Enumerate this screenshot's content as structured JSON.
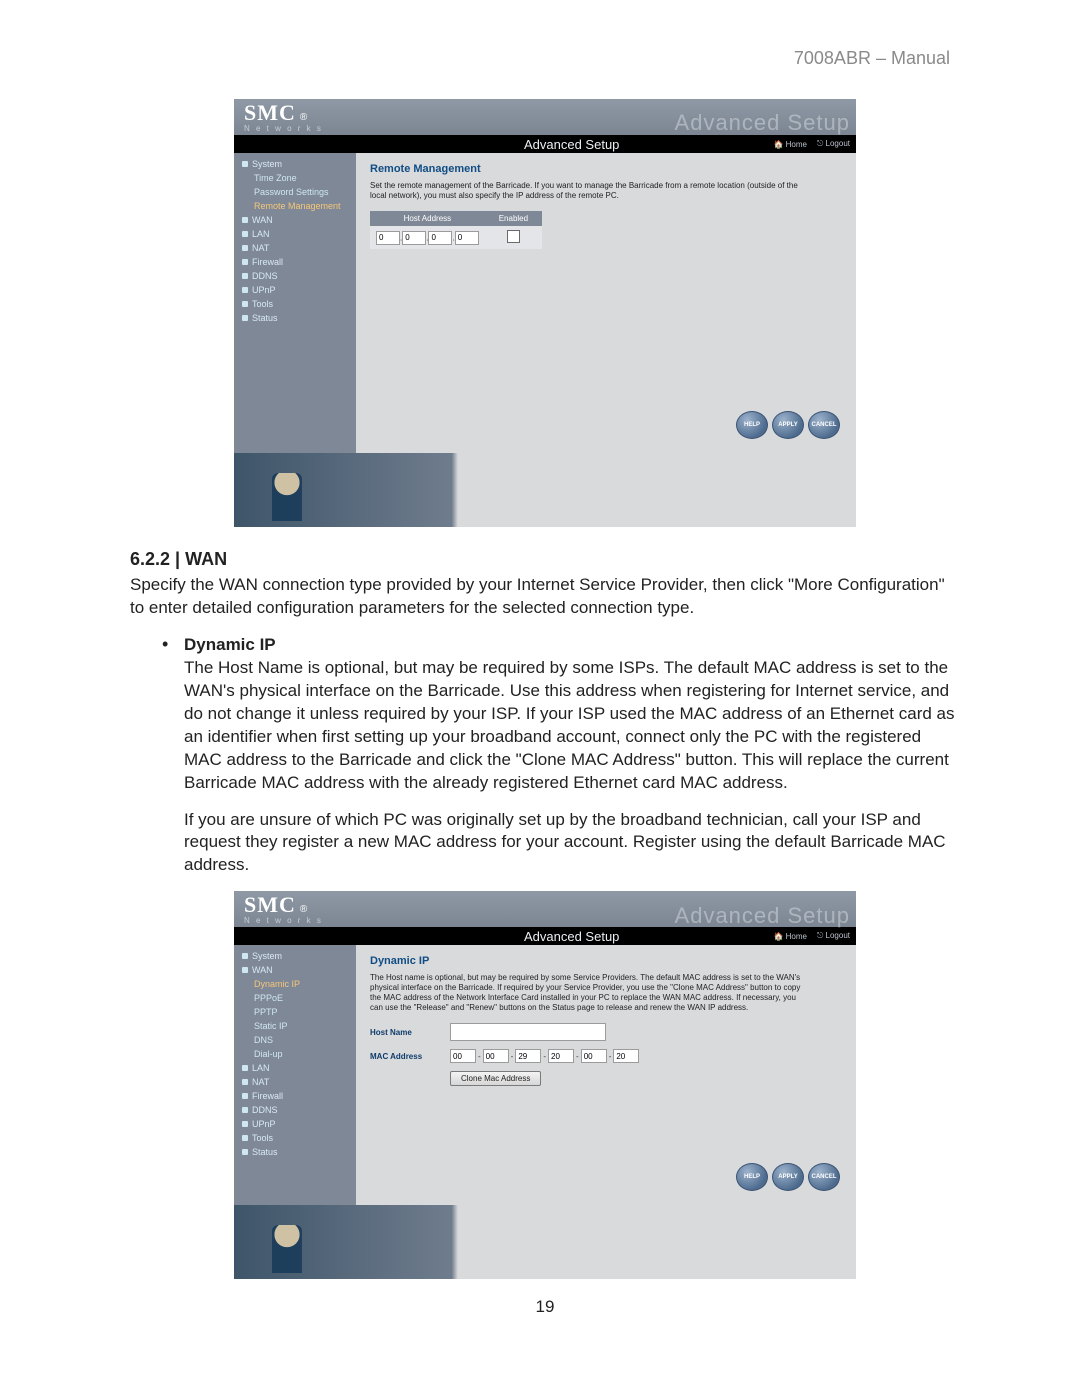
{
  "manual_header": "7008ABR – Manual",
  "page_number": "19",
  "section": {
    "heading": "6.2.2 | WAN",
    "intro": "Specify the WAN connection type provided by your Internet Service Provider, then click \"More Configuration\" to enter detailed configuration parameters for the selected connection type.",
    "bullet_title": "Dynamic IP",
    "p1": "The Host Name is optional, but may be required by some ISPs. The default MAC address is set to the WAN's physical interface on the Barricade. Use this address when registering for Internet service, and do not change it unless required by your ISP. If your ISP used the MAC address of an Ethernet card as an identifier when first setting up your broadband account, connect only the PC with the registered MAC address to the Barricade and click the \"Clone MAC Address\" button. This will replace the current Barricade MAC address with the already registered Ethernet card MAC address.",
    "p2": "If you are unsure of which PC was originally set up by the broadband technician, call your ISP and request they register a new MAC address for your account. Register using the default Barricade MAC address."
  },
  "router_common": {
    "logo_main": "SMC",
    "logo_sub": "N e t w o r k s",
    "ghost_title": "Advanced Setup",
    "bar_title": "Advanced Setup",
    "home": "Home",
    "logout": "Logout",
    "btn_help": "HELP",
    "btn_apply": "APPLY",
    "btn_cancel": "CANCEL"
  },
  "router1": {
    "sidebar": [
      {
        "label": "System",
        "lvl": 1
      },
      {
        "label": "Time Zone",
        "lvl": 2
      },
      {
        "label": "Password Settings",
        "lvl": 2
      },
      {
        "label": "Remote Management",
        "lvl": 2,
        "active": true
      },
      {
        "label": "WAN",
        "lvl": 1
      },
      {
        "label": "LAN",
        "lvl": 1
      },
      {
        "label": "NAT",
        "lvl": 1
      },
      {
        "label": "Firewall",
        "lvl": 1
      },
      {
        "label": "DDNS",
        "lvl": 1
      },
      {
        "label": "UPnP",
        "lvl": 1
      },
      {
        "label": "Tools",
        "lvl": 1
      },
      {
        "label": "Status",
        "lvl": 1
      }
    ],
    "title": "Remote Management",
    "desc": "Set the remote management of the Barricade. If you want to manage the Barricade from a remote location (outside of the local network), you must also specify the IP address of the remote PC.",
    "th_host": "Host Address",
    "th_enabled": "Enabled",
    "ip": [
      "0",
      "0",
      "0",
      "0"
    ]
  },
  "router2": {
    "sidebar": [
      {
        "label": "System",
        "lvl": 1
      },
      {
        "label": "WAN",
        "lvl": 1
      },
      {
        "label": "Dynamic IP",
        "lvl": 2,
        "active": true
      },
      {
        "label": "PPPoE",
        "lvl": 2
      },
      {
        "label": "PPTP",
        "lvl": 2
      },
      {
        "label": "Static IP",
        "lvl": 2
      },
      {
        "label": "DNS",
        "lvl": 2
      },
      {
        "label": "Dial-up",
        "lvl": 2
      },
      {
        "label": "LAN",
        "lvl": 1
      },
      {
        "label": "NAT",
        "lvl": 1
      },
      {
        "label": "Firewall",
        "lvl": 1
      },
      {
        "label": "DDNS",
        "lvl": 1
      },
      {
        "label": "UPnP",
        "lvl": 1
      },
      {
        "label": "Tools",
        "lvl": 1
      },
      {
        "label": "Status",
        "lvl": 1
      }
    ],
    "title": "Dynamic IP",
    "desc": "The Host name is optional, but may be required by some Service Providers. The default MAC address is set to the WAN's physical interface on the Barricade. If required by your Service Provider, you use the \"Clone MAC Address\" button to copy the MAC address of the Network Interface Card installed in your PC to replace the WAN MAC address. If necessary, you can use the \"Release\" and \"Renew\" buttons on the Status page to release and renew the WAN IP address.",
    "host_label": "Host Name",
    "mac_label": "MAC Address",
    "mac": [
      "00",
      "00",
      "29",
      "20",
      "00",
      "20"
    ],
    "clone_btn": "Clone Mac Address"
  }
}
